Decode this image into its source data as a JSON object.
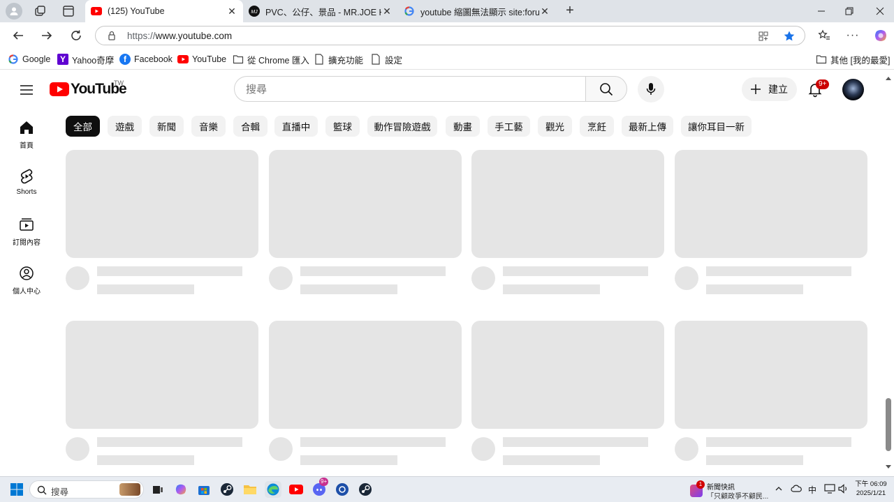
{
  "browser": {
    "tabs": [
      {
        "title": "(125) YouTube",
        "active": true
      },
      {
        "title": "PVC、公仔、景品 - MR.JOE HOBBY",
        "active": false
      },
      {
        "title": "youtube 縮圖無法顯示 site:forum",
        "active": false
      }
    ],
    "url_protocol": "https://",
    "url_host": "www.youtube.com",
    "bookmarks": [
      "Google",
      "Yahoo奇摩",
      "Facebook",
      "YouTube",
      "從 Chrome 匯入",
      "擴充功能",
      "設定"
    ],
    "other_bookmarks": "其他 [我的最愛]"
  },
  "youtube": {
    "logo_text": "YouTube",
    "country_code": "TW",
    "search_placeholder": "搜尋",
    "create_label": "建立",
    "notifications_badge": "9+",
    "guide": [
      {
        "label": "首頁",
        "icon": "home-icon"
      },
      {
        "label": "Shorts",
        "icon": "shorts-icon"
      },
      {
        "label": "訂閱內容",
        "icon": "subscriptions-icon"
      },
      {
        "label": "個人中心",
        "icon": "account-icon"
      }
    ],
    "chips": [
      "全部",
      "遊戲",
      "新聞",
      "音樂",
      "合輯",
      "直播中",
      "籃球",
      "動作冒險遊戲",
      "動畫",
      "手工藝",
      "觀光",
      "烹飪",
      "最新上傳",
      "讓你耳目一新"
    ],
    "selected_chip": "全部"
  },
  "taskbar": {
    "search_placeholder": "搜尋",
    "news_title": "新聞快訊",
    "news_subtitle": "「只顧政爭不顧民...",
    "news_badge": "1",
    "ime": "中",
    "time": "下午 06:09",
    "date": "2025/1/21",
    "discord_badge": "9+"
  },
  "colors": {
    "youtube_red": "#ff0000",
    "chip_selected_bg": "#0f0f0f",
    "chip_bg": "#f2f2f2",
    "skeleton": "#e5e5e5",
    "edge_accent": "#0067c0"
  }
}
